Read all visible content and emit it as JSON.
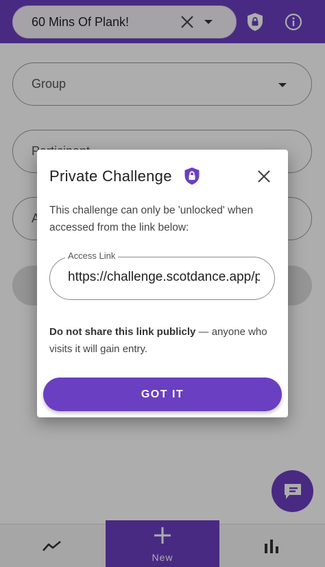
{
  "appbar": {
    "challenge_value": "60 Mins Of Plank!"
  },
  "form": {
    "group_label": "Group",
    "participant_label": "Participant",
    "activity_label": "A"
  },
  "bottom_nav": {
    "new_label": "New"
  },
  "dialog": {
    "title": "Private Challenge",
    "body": "This challenge can only be 'unlocked' when accessed from the link below:",
    "link_label": "Access Link",
    "link_value": "https://challenge.scotdance.app/p",
    "warning_bold": "Do not share this link publicly",
    "warning_rest": " — anyone who visits it will gain entry.",
    "button_label": "GOT IT"
  },
  "colors": {
    "primary": "#6a3fc1",
    "scrim": "rgba(0,0,0,0.32)",
    "dialog_bg": "#ffffff"
  },
  "icons": {
    "appbar_clear": "close-icon",
    "appbar_dropdown": "chevron-down-icon",
    "appbar_private": "shield-lock-icon",
    "appbar_info": "info-icon",
    "dialog_private": "shield-lock-icon",
    "dialog_close": "close-icon",
    "fab": "chat-icon",
    "nav_trends": "trending-icon",
    "nav_new": "plus-icon",
    "nav_stats": "bar-chart-icon"
  }
}
